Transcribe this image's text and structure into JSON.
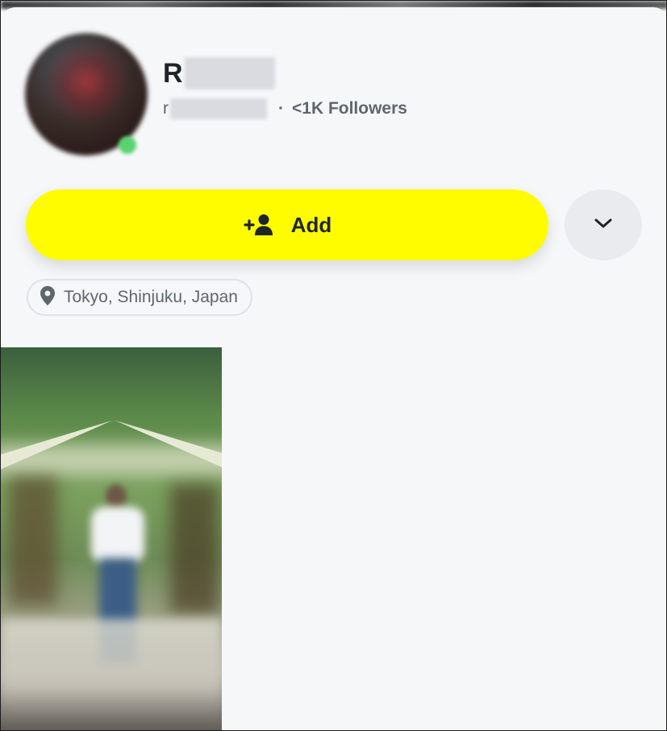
{
  "profile": {
    "name_visible_initial": "R",
    "username_visible_initial": "r",
    "separator": "·",
    "followers": "<1K Followers"
  },
  "actions": {
    "add_label": "Add"
  },
  "location": {
    "label": "Tokyo, Shinjuku, Japan"
  },
  "colors": {
    "add_button": "#fffc00",
    "background": "#f6f7f9",
    "text_primary": "#1f2429",
    "text_secondary": "#5f666d",
    "online": "#58d36f"
  },
  "icons": {
    "add_friend": "add-friend-icon",
    "chevron": "chevron-down-icon",
    "location": "location-pin-icon"
  }
}
